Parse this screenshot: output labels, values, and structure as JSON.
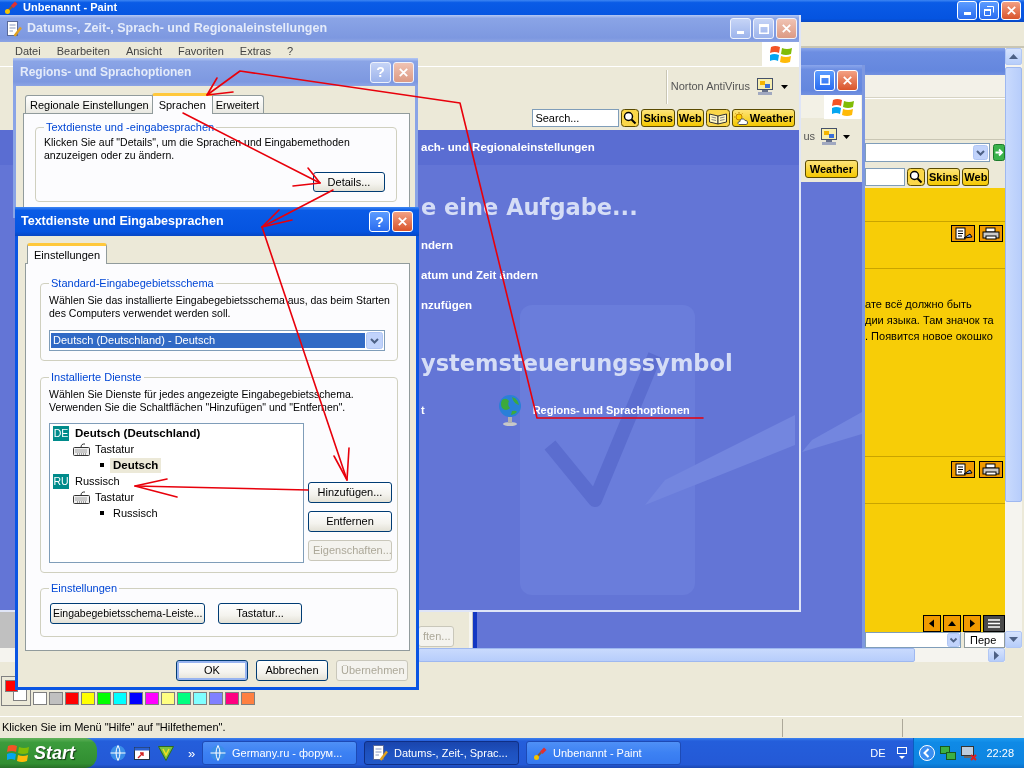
{
  "paint": {
    "title": "Unbenannt - Paint",
    "controls": [
      {
        "kind": "minimize"
      },
      {
        "kind": "restore"
      },
      {
        "kind": "close"
      }
    ],
    "annotations": [
      {
        "kind": "arrow"
      },
      {
        "kind": "arrow"
      },
      {
        "kind": "arrow"
      },
      {
        "kind": "arrow"
      },
      {
        "kind": "arrow"
      }
    ],
    "palette": [
      {
        "color": "#ffffff"
      },
      {
        "color": "#c0c0c0"
      },
      {
        "color": "#ff0000"
      },
      {
        "color": "#ffff00"
      },
      {
        "color": "#00ff00"
      },
      {
        "color": "#00ffff"
      },
      {
        "color": "#0000ff"
      },
      {
        "color": "#ff00ff"
      },
      {
        "color": "#ffff80"
      },
      {
        "color": "#00ff80"
      },
      {
        "color": "#80ffff"
      },
      {
        "color": "#8080ff"
      },
      {
        "color": "#ff0080"
      },
      {
        "color": "#ff8040"
      }
    ],
    "status_text": "Klicken Sie im Menü \"Hilfe\" auf \"Hilfethemen\"."
  },
  "browser_window": {
    "toolbar_buttons": [
      {
        "label": "Skins"
      },
      {
        "label": "Web"
      }
    ],
    "text_lines": [
      "ате всё должно быть",
      "дии языка. Там значок та",
      ". Появится новое окошко"
    ],
    "bottom_field": "Пере"
  },
  "explorer_window": {
    "controls": [
      {
        "kind": "maximize"
      },
      {
        "kind": "close"
      }
    ],
    "toolbar_label": "us",
    "weather_button": "Weather"
  },
  "control_panel": {
    "title": "Datums-, Zeit-, Sprach- und Regionaleinstellungen",
    "active": false,
    "controls": [
      {
        "kind": "minimize"
      },
      {
        "kind": "maximize"
      },
      {
        "kind": "close"
      }
    ],
    "menu": [
      "Datei",
      "Bearbeiten",
      "Ansicht",
      "Favoriten",
      "Extras",
      "?"
    ],
    "toolbar_label": "Norton AntiVirus",
    "search": {
      "placeholder": "Search..."
    },
    "toolbar_buttons": [
      {
        "kind": "text",
        "label": "Skins"
      },
      {
        "kind": "text",
        "label": "Web"
      },
      {
        "kind": "book"
      },
      {
        "kind": "weather",
        "label": "Weather"
      }
    ],
    "header": "ach- und Regionaleinstellungen",
    "task_heading": "e eine Aufgabe...",
    "tasks": [
      "ndern",
      "atum und Zeit ändern",
      "nzufügen"
    ],
    "icon_heading": "ystemsteuerungssymbol",
    "icon_items": [
      {
        "kind": "plain",
        "label": "t"
      },
      {
        "kind": "globe",
        "label": "Regions- und Sprachoptionen"
      }
    ]
  },
  "fragment_dialog": {
    "buttons": [
      {
        "label": "ften...",
        "disabled": true
      }
    ]
  },
  "regions_dialog": {
    "title": "Regions- und Sprachoptionen",
    "active": false,
    "controls": [
      {
        "kind": "help",
        "label": "?"
      },
      {
        "kind": "close"
      }
    ],
    "tabs": [
      {
        "label": "Regionale Einstellungen",
        "selected": false
      },
      {
        "label": "Sprachen",
        "selected": true
      },
      {
        "label": "Erweitert",
        "selected": false
      }
    ],
    "group": {
      "title": "Textdienste und -eingabesprachen",
      "text": "Klicken Sie auf \"Details\", um die Sprachen und Eingabemethoden anzuzeigen oder zu ändern.",
      "button": "Details..."
    }
  },
  "text_services_dialog": {
    "title": "Textdienste und Eingabesprachen",
    "active": true,
    "controls": [
      {
        "kind": "help",
        "label": "?"
      },
      {
        "kind": "close"
      }
    ],
    "tabs": [
      {
        "label": "Einstellungen",
        "selected": true
      }
    ],
    "default_group": {
      "title": "Standard-Eingabegebietsschema",
      "text": "Wählen Sie das installierte Eingabegebietsschema aus, das beim Starten des Computers verwendet werden soll.",
      "dropdown": {
        "value": "Deutsch (Deutschland) - Deutsch",
        "focused": true
      }
    },
    "services_group": {
      "title": "Installierte Dienste",
      "text": "Wählen Sie Dienste für jedes angezeigte Eingabegebietsschema. Verwenden Sie die Schaltflächen \"Hinzufügen\" und \"Entfernen\".",
      "languages": [
        {
          "badge": "DE",
          "label": "Deutsch (Deutschland)",
          "default": true,
          "children": [
            {
              "kind": "keyboard",
              "label": "Tastatur",
              "children": [
                {
                  "label": "Deutsch",
                  "default": true,
                  "selected": true
                }
              ]
            }
          ]
        },
        {
          "badge": "RU",
          "label": "Russisch",
          "default": false,
          "children": [
            {
              "kind": "keyboard",
              "label": "Tastatur",
              "children": [
                {
                  "label": "Russisch",
                  "default": false,
                  "selected": false
                }
              ]
            }
          ]
        }
      ],
      "buttons": [
        {
          "label": "Hinzufügen...",
          "disabled": false
        },
        {
          "label": "Entfernen",
          "disabled": false
        },
        {
          "label": "Eigenschaften...",
          "disabled": true
        }
      ]
    },
    "settings_group": {
      "title": "Einstellungen",
      "buttons": [
        {
          "label": "Eingabegebietsschema-Leiste..."
        },
        {
          "label": "Tastatur..."
        }
      ]
    },
    "footer_buttons": [
      {
        "label": "OK",
        "default": true,
        "disabled": false
      },
      {
        "label": "Abbrechen",
        "default": false,
        "disabled": false
      },
      {
        "label": "Übernehmen",
        "default": false,
        "disabled": true
      }
    ]
  },
  "taskbar": {
    "start": "Start",
    "overflow": "»",
    "tasks": [
      {
        "kind": "browser",
        "label": "Germany.ru - форум...",
        "selected": false
      },
      {
        "kind": "settings",
        "label": "Datums-, Zeit-, Sprac...",
        "selected": true
      },
      {
        "kind": "paint",
        "label": "Unbenannt - Paint",
        "selected": false
      }
    ],
    "language": "DE",
    "clock": "22:28"
  }
}
